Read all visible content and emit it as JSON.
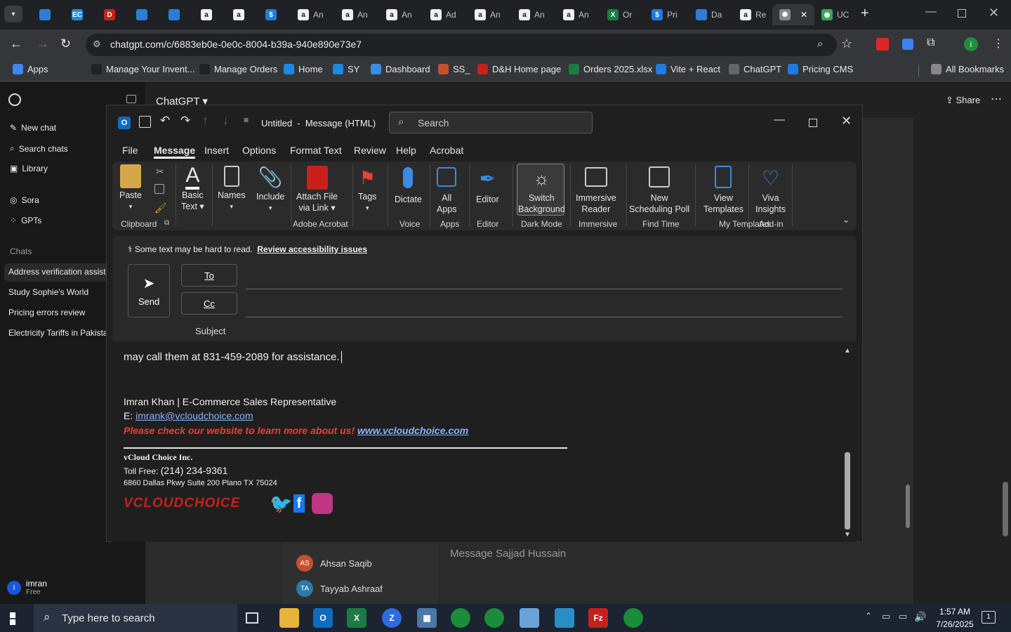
{
  "browser": {
    "tabs": [
      {
        "label": "",
        "icon": "chevron-down-icon"
      },
      {
        "label": "",
        "icon": "app-icon"
      },
      {
        "label": "",
        "icon": "ec-icon"
      },
      {
        "label": "",
        "icon": "dh-icon"
      },
      {
        "label": "",
        "icon": "app-icon"
      },
      {
        "label": "",
        "icon": "app-icon"
      },
      {
        "label": "",
        "icon": "amazon-icon"
      },
      {
        "label": "",
        "icon": "amazon-icon"
      },
      {
        "label": "",
        "icon": "dollar-icon"
      },
      {
        "label": "An",
        "icon": "amazon-icon"
      },
      {
        "label": "An",
        "icon": "amazon-icon"
      },
      {
        "label": "An",
        "icon": "amazon-icon"
      },
      {
        "label": "Ad",
        "icon": "amazon-icon"
      },
      {
        "label": "An",
        "icon": "amazon-icon"
      },
      {
        "label": "An",
        "icon": "amazon-icon"
      },
      {
        "label": "An",
        "icon": "amazon-icon"
      },
      {
        "label": "Or",
        "icon": "excel-icon"
      },
      {
        "label": "Pri",
        "icon": "dollar-icon"
      },
      {
        "label": "Da",
        "icon": "app-icon"
      },
      {
        "label": "Re",
        "icon": "amazon-icon"
      },
      {
        "label": "",
        "icon": "chatgpt-icon"
      },
      {
        "label": "UC",
        "icon": "maps-icon"
      }
    ],
    "url": "chatgpt.com/c/6883eb0e-0e0c-8004-b39a-940e890e73e7",
    "profile_initial": "i",
    "bookmarks": [
      {
        "label": "Apps"
      },
      {
        "label": "Manage Your Invent..."
      },
      {
        "label": "Manage Orders"
      },
      {
        "label": "Home"
      },
      {
        "label": "SY"
      },
      {
        "label": "Dashboard"
      },
      {
        "label": "SS_"
      },
      {
        "label": "D&H Home page"
      },
      {
        "label": "Orders 2025.xlsx"
      },
      {
        "label": "Vite + React"
      },
      {
        "label": "ChatGPT"
      },
      {
        "label": "Pricing CMS"
      },
      {
        "label": "All Bookmarks"
      }
    ]
  },
  "chatgpt": {
    "header_title": "ChatGPT",
    "share_label": "Share",
    "sidebar": {
      "new_chat": "New chat",
      "search_chats": "Search chats",
      "library": "Library",
      "sora": "Sora",
      "gpts": "GPTs",
      "chats_heading": "Chats",
      "chats": [
        "Address verification assistan",
        "Study Sophie's World",
        "Pricing errors review",
        "Electricity Tariffs in Pakistan"
      ]
    },
    "user": {
      "name": "imran",
      "plan": "Free",
      "initial": "I"
    }
  },
  "background_app": {
    "contacts": [
      {
        "initials": "AS",
        "name": "Ahsan Saqib",
        "color": "#c4512d"
      },
      {
        "initials": "TA",
        "name": "Tayyab Ashraaf",
        "color": "#2a7ba8"
      }
    ],
    "message_placeholder": "Message Sajjad Hussain"
  },
  "outlook": {
    "title": "Untitled  -  Message (HTML)",
    "search_placeholder": "Search",
    "menu": [
      "File",
      "Message",
      "Insert",
      "Options",
      "Format Text",
      "Review",
      "Help",
      "Acrobat"
    ],
    "active_menu": "Message",
    "ribbon": {
      "paste": "Paste",
      "basic_text": [
        "Basic",
        "Text"
      ],
      "names": "Names",
      "include": "Include",
      "attach": [
        "Attach File",
        "via Link"
      ],
      "tags": "Tags",
      "dictate": "Dictate",
      "all_apps": [
        "All",
        "Apps"
      ],
      "editor": "Editor",
      "switch_bg": [
        "Switch",
        "Background"
      ],
      "immersive": [
        "Immersive",
        "Reader"
      ],
      "new_poll": [
        "New",
        "Scheduling Poll"
      ],
      "view_templates": [
        "View",
        "Templates"
      ],
      "viva": [
        "Viva",
        "Insights"
      ],
      "groups": [
        "Clipboard",
        "Adobe Acrobat",
        "Voice",
        "Apps",
        "Editor",
        "Dark Mode",
        "Immersive",
        "Find Time",
        "My Templates",
        "Add-in"
      ]
    },
    "accessibility_notice": "Some text may be hard to read.",
    "accessibility_link": "Review accessibility issues",
    "send": "Send",
    "to": "To",
    "cc": "Cc",
    "subject": "Subject",
    "body": {
      "partial_line": "may call them at 831-459-2089 for assistance.",
      "sig_name": "Imran Khan | E-Commerce Sales Representative",
      "email_prefix": "E: ",
      "email": "imrank@vcloudchoice.com",
      "promo": "Please check our website to learn more about us!",
      "website": "www.vcloudchoice.com",
      "company": "vCloud Choice Inc.",
      "tollfree_label": "Toll Free: ",
      "tollfree": "(214) 234-9361",
      "address": "6860 Dallas Pkwy Suite 200 Plano TX 75024",
      "logo_text": "VCLOUDCHOICE"
    }
  },
  "taskbar": {
    "search_placeholder": "Type here to search",
    "time": "1:57 AM",
    "date": "7/26/2025",
    "notification_count": "1"
  },
  "colors": {
    "accent_red": "#e8403a",
    "link_blue": "#8ab4f8",
    "chrome_dark": "#202124",
    "outlook_blue": "#0f6cbd"
  }
}
